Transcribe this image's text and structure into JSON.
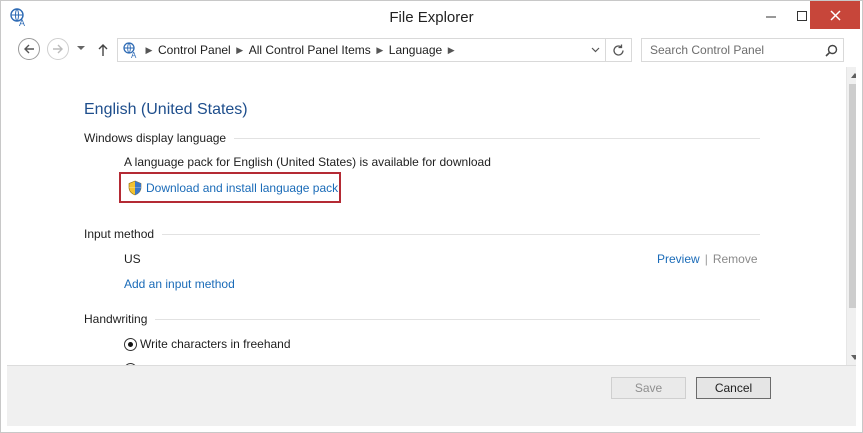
{
  "window": {
    "title": "File Explorer",
    "colors": {
      "close_button": "#c7463a",
      "link": "#1a6bb8",
      "heading": "#1e4e8c",
      "highlight_border": "#b42a34"
    }
  },
  "titlebar": {
    "app_icon": "language-icon",
    "minimize_icon": "minimize-icon",
    "maximize_icon": "maximize-icon",
    "close_icon": "close-icon"
  },
  "navigation": {
    "back_icon": "back-arrow-icon",
    "forward_icon": "forward-arrow-icon",
    "recent_icon": "chevron-down-icon",
    "up_icon": "up-arrow-icon",
    "breadcrumbs": [
      "Control Panel",
      "All Control Panel Items",
      "Language"
    ],
    "refresh_icon": "refresh-icon"
  },
  "search": {
    "placeholder": "Search Control Panel",
    "value": "",
    "icon": "search-icon"
  },
  "main": {
    "heading": "English (United States)",
    "display_language": {
      "section_label": "Windows display language",
      "status_text": "A language pack for English (United States) is available for download",
      "download_link": "Download and install language pack"
    },
    "input_method": {
      "section_label": "Input method",
      "current": "US",
      "preview_link": "Preview",
      "separator": "|",
      "remove_link": "Remove",
      "add_link": "Add an input method"
    },
    "handwriting": {
      "section_label": "Handwriting",
      "options": [
        {
          "label": "Write characters in freehand",
          "selected": true
        }
      ]
    }
  },
  "footer": {
    "save_label": "Save",
    "save_enabled": false,
    "cancel_label": "Cancel"
  }
}
